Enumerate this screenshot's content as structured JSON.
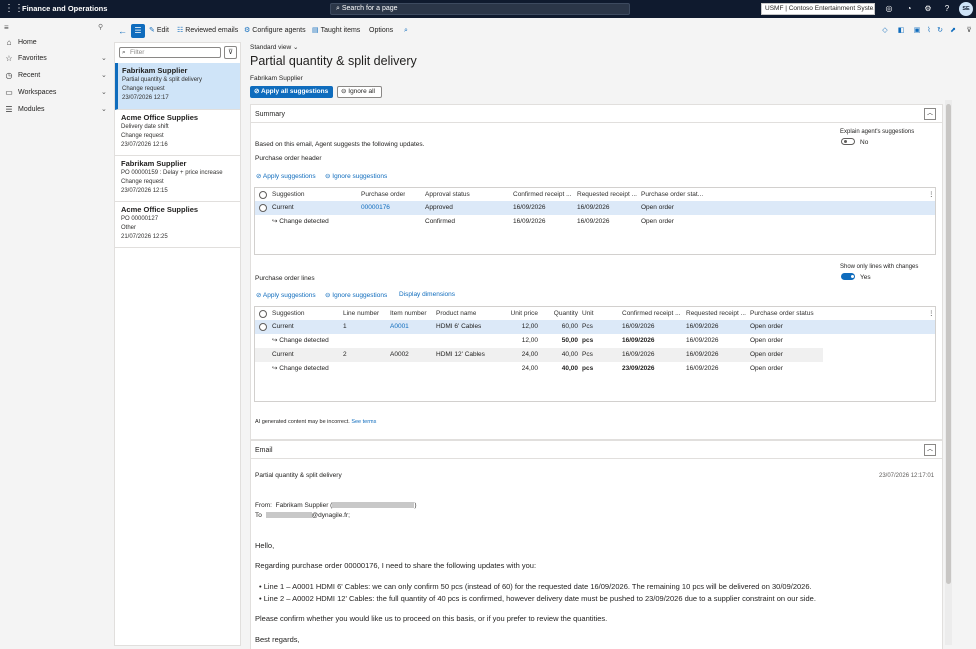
{
  "topbar": {
    "app_name": "Finance and Operations",
    "search_placeholder": "Search for a page",
    "company": "USMF | Contoso Entertainment Syste...",
    "avatar": "SE"
  },
  "nav": {
    "items": [
      {
        "label": "Home"
      },
      {
        "label": "Favorites"
      },
      {
        "label": "Recent"
      },
      {
        "label": "Workspaces"
      },
      {
        "label": "Modules"
      }
    ]
  },
  "commands": {
    "edit": "Edit",
    "reviewed_emails": "Reviewed emails",
    "configure_agents": "Configure agents",
    "taught_items": "Taught items",
    "options": "Options"
  },
  "list": {
    "filter_placeholder": "Filter",
    "cards": [
      {
        "title": "Fabrikam Supplier",
        "line1": "Partial quantity & split delivery",
        "line2": "Change request",
        "line3": "23/07/2026 12:17"
      },
      {
        "title": "Acme Office Supplies",
        "line1": "Delivery date shift",
        "line2": "Change request",
        "line3": "23/07/2026 12:16"
      },
      {
        "title": "Fabrikam Supplier",
        "line1": "PO 00000159 : Delay + price increase",
        "line2": "Change request",
        "line3": "23/07/2026 12:15"
      },
      {
        "title": "Acme Office Supplies",
        "line1": "PO 00000127",
        "line2": "Other",
        "line3": "21/07/2026 12:25"
      }
    ]
  },
  "main": {
    "view": "Standard view",
    "title": "Partial quantity & split delivery",
    "subtitle": "Fabrikam Supplier",
    "apply_all": "Apply all suggestions",
    "ignore_all": "Ignore all"
  },
  "summary": {
    "title": "Summary",
    "intro": "Based on this email, Agent suggests the following updates.",
    "explain_label": "Explain agent's suggestions",
    "explain_value": "No",
    "header_title": "Purchase order header",
    "apply": "Apply suggestions",
    "ignore": "Ignore suggestions",
    "header_cols": [
      "Suggestion",
      "Purchase order",
      "Approval status",
      "Confirmed receipt ...",
      "Requested receipt ...",
      "Purchase order stat..."
    ],
    "header_rows": [
      [
        "Current",
        "00000176",
        "Approved",
        "16/09/2026",
        "16/09/2026",
        "Open order"
      ],
      [
        "↪ Change detected",
        "",
        "Confirmed",
        "16/09/2026",
        "16/09/2026",
        "Open order"
      ]
    ],
    "lines_title": "Purchase order lines",
    "show_only_label": "Show only lines with changes",
    "show_only_value": "Yes",
    "display_dimensions": "Display dimensions",
    "line_cols": [
      "Suggestion",
      "Line number",
      "Item number",
      "Product name",
      "Unit price",
      "Quantity",
      "Unit",
      "Confirmed receipt ...",
      "Requested receipt ...",
      "Purchase order status"
    ],
    "line_rows": [
      [
        "Current",
        "1",
        "A0001",
        "HDMI 6' Cables",
        "12,00",
        "60,00",
        "Pcs",
        "16/09/2026",
        "16/09/2026",
        "Open order"
      ],
      [
        "↪ Change detected",
        "",
        "",
        "",
        "12,00",
        "50,00",
        "pcs",
        "16/09/2026",
        "16/09/2026",
        "Open order"
      ],
      [
        "Current",
        "2",
        "A0002",
        "HDMI 12' Cables",
        "24,00",
        "40,00",
        "Pcs",
        "16/09/2026",
        "16/09/2026",
        "Open order"
      ],
      [
        "↪ Change detected",
        "",
        "",
        "",
        "24,00",
        "40,00",
        "pcs",
        "23/09/2026",
        "16/09/2026",
        "Open order"
      ]
    ],
    "ai_note": "AI generated content may be incorrect.",
    "see_terms": "See terms"
  },
  "email": {
    "title": "Email",
    "subject": "Partial quantity & split delivery",
    "date": "23/07/2026 12:17:01",
    "from_label": "From:",
    "from_name": "Fabrikam Supplier (",
    "from_close": ")",
    "to_label": "To",
    "to_domain": "@dynagile.fr;",
    "greeting": "Hello,",
    "para1": "Regarding purchase order 00000176, I need to share the following updates with you:",
    "bullet1": "Line 1 – A0001 HDMI 6' Cables: we can only confirm 50 pcs (instead of 60) for the requested date 16/09/2026. The remaining 10 pcs will be delivered on 30/09/2026.",
    "bullet2": "Line 2 – A0002 HDMI 12' Cables: the full quantity of 40 pcs is confirmed, however delivery date must be pushed to 23/09/2026 due to a supplier constraint on our side.",
    "para2": "Please confirm whether you would like us to proceed on this basis, or if you prefer to review the quantities.",
    "closing": "Best regards,"
  }
}
